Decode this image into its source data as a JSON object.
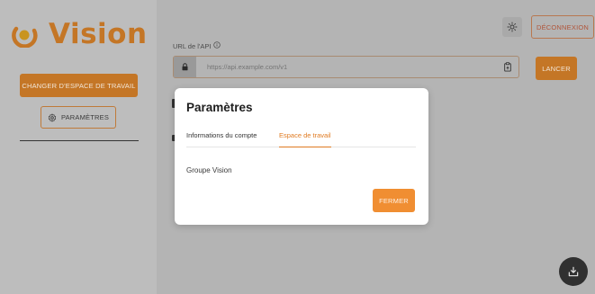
{
  "sidebar": {
    "logo_text": "Vision",
    "workspace_button": "CHANGER D'ESPACE DE TRAVAIL",
    "params_button": "PARAMÈTRES"
  },
  "header": {
    "theme_icon": "sun-icon",
    "logout_button": "DÉCONNEXION"
  },
  "api": {
    "label": "URL de l'API",
    "info_icon": "info-icon",
    "placeholder": "https://api.example.com/v1",
    "lock_icon": "lock-icon",
    "clipboard_icon": "clipboard-icon",
    "launch_button": "LANCER"
  },
  "modal": {
    "title": "Paramètres",
    "tabs": [
      {
        "label": "Informations du compte",
        "active": false
      },
      {
        "label": "Espace de travail",
        "active": true
      }
    ],
    "workspace_name": "Groupe Vision",
    "close_button": "FERMER"
  },
  "fab": {
    "icon": "download-tray-icon"
  },
  "colors": {
    "accent": "#c47626",
    "accent_bright": "#f08e32",
    "logout_text": "#b0553a",
    "overlay_bg": "#b4b4b4"
  }
}
